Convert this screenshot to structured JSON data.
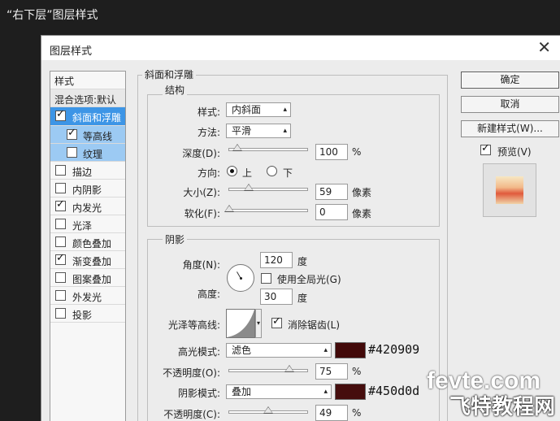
{
  "caption": "“右下层”图层样式",
  "dialog": {
    "title": "图层样式",
    "close": "✕"
  },
  "left_panel": {
    "header": "样式",
    "items": [
      {
        "label": "混合选项:默认",
        "checked": null,
        "state": "normal"
      },
      {
        "label": "斜面和浮雕",
        "checked": true,
        "state": "selected"
      },
      {
        "label": "等高线",
        "checked": true,
        "state": "sub"
      },
      {
        "label": "纹理",
        "checked": false,
        "state": "sub"
      },
      {
        "label": "描边",
        "checked": false,
        "state": "normal"
      },
      {
        "label": "内阴影",
        "checked": false,
        "state": "normal"
      },
      {
        "label": "内发光",
        "checked": true,
        "state": "normal"
      },
      {
        "label": "光泽",
        "checked": false,
        "state": "normal"
      },
      {
        "label": "颜色叠加",
        "checked": false,
        "state": "normal"
      },
      {
        "label": "渐变叠加",
        "checked": true,
        "state": "normal"
      },
      {
        "label": "图案叠加",
        "checked": false,
        "state": "normal"
      },
      {
        "label": "外发光",
        "checked": false,
        "state": "normal"
      },
      {
        "label": "投影",
        "checked": false,
        "state": "normal"
      }
    ]
  },
  "bevel": {
    "title": "斜面和浮雕",
    "structure": {
      "title": "结构",
      "style_label": "样式:",
      "style_value": "内斜面",
      "method_label": "方法:",
      "method_value": "平滑",
      "depth_label": "深度(D):",
      "depth_value": "100",
      "depth_unit": "%",
      "depth_fraction": 0.1,
      "direction_label": "方向:",
      "direction_up": "上",
      "direction_down": "下",
      "direction_selected": "上",
      "size_label": "大小(Z):",
      "size_value": "59",
      "size_unit": "像素",
      "size_fraction": 0.24,
      "soften_label": "软化(F):",
      "soften_value": "0",
      "soften_unit": "像素",
      "soften_fraction": 0.0
    },
    "shading": {
      "title": "阴影",
      "angle_label": "角度(N):",
      "angle_value": "120",
      "angle_unit": "度",
      "global_light_label": "使用全局光(G)",
      "global_light_checked": false,
      "altitude_label": "高度:",
      "altitude_value": "30",
      "altitude_unit": "度",
      "gloss_contour_label": "光泽等高线:",
      "antialias_label": "消除锯齿(L)",
      "antialias_checked": true,
      "highlight_mode_label": "高光模式:",
      "highlight_mode_value": "滤色",
      "highlight_color": "#420909",
      "highlight_hex": "#420909",
      "highlight_opacity_label": "不透明度(O):",
      "highlight_opacity_value": "75",
      "highlight_opacity_unit": "%",
      "highlight_opacity_fraction": 0.75,
      "shadow_mode_label": "阴影模式:",
      "shadow_mode_value": "叠加",
      "shadow_color": "#450d0d",
      "shadow_hex": "#450d0d",
      "shadow_opacity_label": "不透明度(C):",
      "shadow_opacity_value": "49",
      "shadow_opacity_unit": "%",
      "shadow_opacity_fraction": 0.49
    }
  },
  "buttons": {
    "ok": "确定",
    "cancel": "取消",
    "new_style": "新建样式(W)...",
    "preview_label": "预览(V)",
    "preview_checked": true
  },
  "watermark": {
    "line1": "fevte.com",
    "line2": "飞特教程网"
  }
}
